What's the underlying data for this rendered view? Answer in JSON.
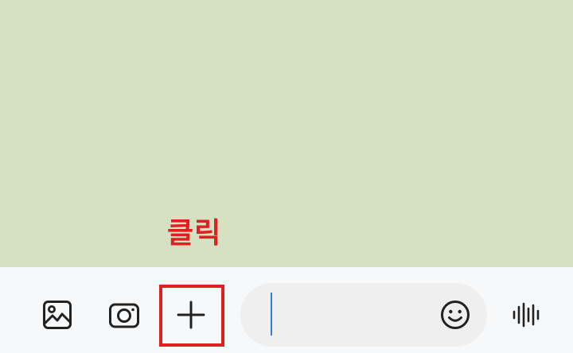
{
  "annotation": {
    "label": "클릭"
  },
  "toolbar": {
    "gallery_icon": "image-icon",
    "camera_icon": "camera-icon",
    "plus_icon": "plus-icon",
    "emoji_icon": "smiley-icon",
    "voice_icon": "voice-waveform-icon"
  },
  "message_input": {
    "value": "",
    "placeholder": ""
  },
  "colors": {
    "chat_background": "#d6e1c4",
    "toolbar_background": "#f7f8fa",
    "input_background": "#efefef",
    "highlight_red": "#e0201f",
    "caret_blue": "#3a7bd5",
    "icon_dark": "#222222"
  }
}
